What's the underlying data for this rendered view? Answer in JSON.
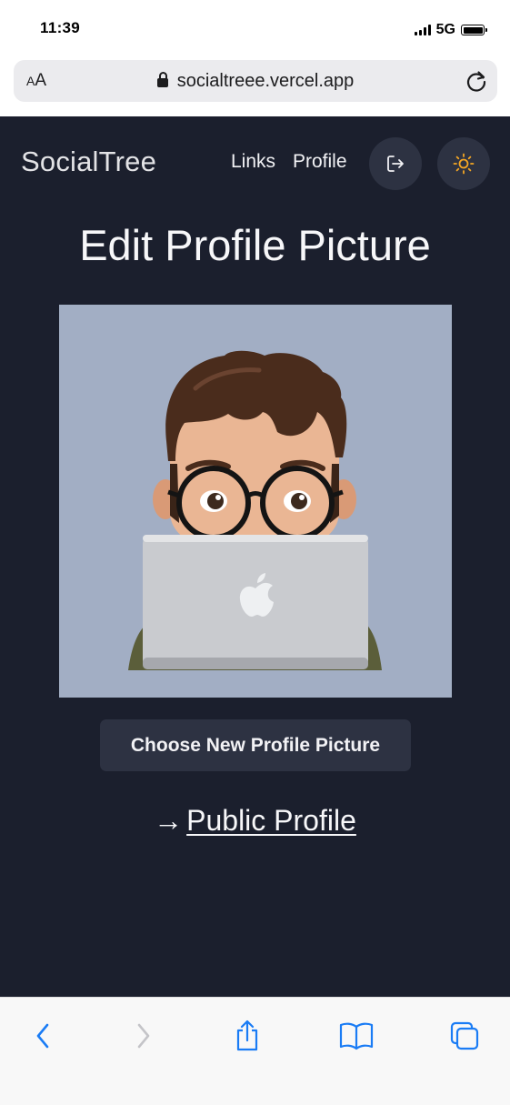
{
  "status_bar": {
    "time": "11:39",
    "network": "5G"
  },
  "browser": {
    "text_size_label_small": "A",
    "text_size_label_large": "A",
    "url": "socialtreee.vercel.app"
  },
  "nav": {
    "brand": "SocialTree",
    "links_label": "Links",
    "profile_label": "Profile"
  },
  "main": {
    "title": "Edit Profile Picture",
    "choose_button_label": "Choose New Profile Picture",
    "public_profile_arrow": "→",
    "public_profile_label": "Public Profile"
  },
  "colors": {
    "page_background": "#1b1f2d",
    "button_background": "#2d3242",
    "avatar_background": "#a2aec4",
    "sun_accent": "#f5a623",
    "safari_blue": "#1a7cf5"
  },
  "icons": {
    "logout": "logout-icon",
    "theme": "sun-icon",
    "lock": "lock-icon",
    "reload": "reload-icon",
    "back": "chevron-left-icon",
    "forward": "chevron-right-icon",
    "share": "share-icon",
    "bookmarks": "book-icon",
    "tabs": "tabs-icon"
  }
}
